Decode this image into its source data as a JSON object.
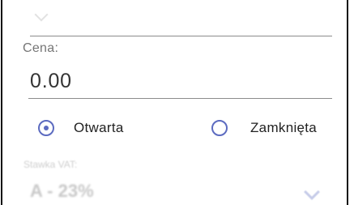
{
  "previous_field": {
    "icon": "chevron-down-icon"
  },
  "price": {
    "label": "Cena:",
    "value": "0.00"
  },
  "status_options": [
    {
      "label": "Otwarta",
      "selected": true
    },
    {
      "label": "Zamknięta",
      "selected": false
    }
  ],
  "vat": {
    "label": "Stawka VAT:",
    "value": "A - 23%",
    "icon": "chevron-down-icon"
  },
  "colors": {
    "accent": "#5c6bc0",
    "underline": "#8c8c8c",
    "label": "#757575"
  }
}
